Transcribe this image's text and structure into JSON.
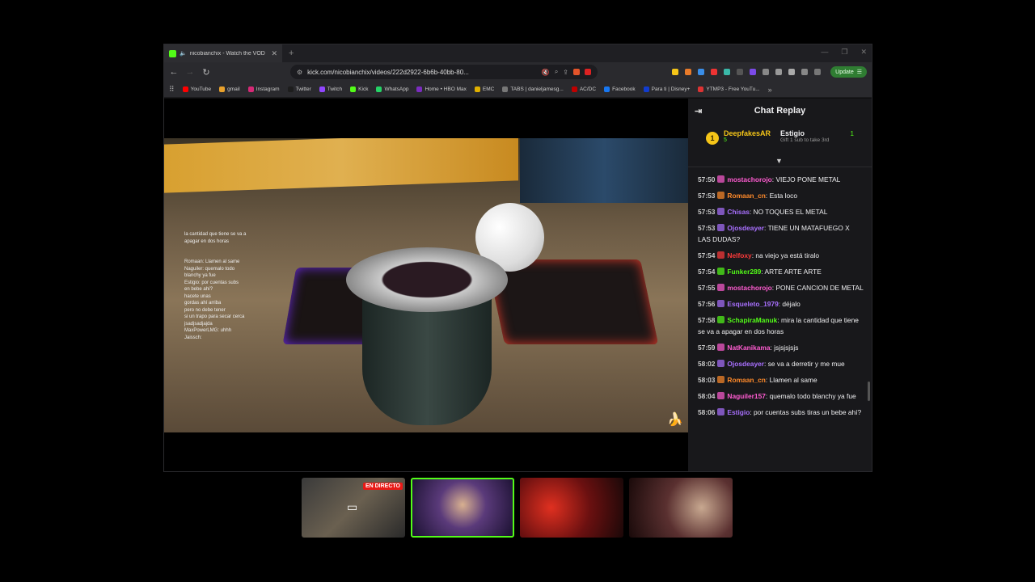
{
  "browser": {
    "tab_title": "nicobianchix - Watch the VOD",
    "new_tab_glyph": "+",
    "url": "kick.com/nicobianchix/videos/222d2922-6b6b-40bb-80...",
    "update_label": "Update",
    "bookmarks": [
      {
        "label": "YouTube",
        "color": "#ff0000"
      },
      {
        "label": "gmail",
        "color": "#e8a12c"
      },
      {
        "label": "Instagram",
        "color": "#d62976"
      },
      {
        "label": "Twitter",
        "color": "#1d1d1d"
      },
      {
        "label": "Twitch",
        "color": "#9146ff"
      },
      {
        "label": "Kick",
        "color": "#53fc18"
      },
      {
        "label": "WhatsApp",
        "color": "#25d366"
      },
      {
        "label": "Home • HBO Max",
        "color": "#7b2cbf"
      },
      {
        "label": "EMC",
        "color": "#e0b000"
      },
      {
        "label": "TABS | danieljamesg...",
        "color": "#777777"
      },
      {
        "label": "AC/DC",
        "color": "#c00000"
      },
      {
        "label": "Facebook",
        "color": "#1877f2"
      },
      {
        "label": "Para ti | Disney+",
        "color": "#113ccf"
      },
      {
        "label": "YTMP3 - Free YouTu...",
        "color": "#d33"
      }
    ]
  },
  "video": {
    "overlay_lines": [
      "la cantidad que tiene se va a",
      "apagar en dos horas",
      "",
      "",
      "Romaan: Llamen al same",
      "Naguiler: quemalo todo",
      "blanchy ya fue",
      "Estigio: por cuentas subs",
      "en bebe ahí?",
      "hacete unas",
      "gordas ahí arriba",
      "pero no debe tener",
      "si un trapo para secar cerca",
      "jsadjsadjajda",
      "MaxPowerLMG: uhhh",
      "Jaissch:"
    ],
    "banana": "🍌"
  },
  "chat": {
    "title": "Chat Replay",
    "pinned": {
      "first": {
        "rank": "1",
        "name": "DeepfakesAR",
        "count": "5"
      },
      "second": {
        "name": "Estigio",
        "subtitle": "Gift 1 sub to take 3rd",
        "count": "1"
      }
    },
    "messages": [
      {
        "time": "57:50",
        "user": "mostachorojo",
        "color": "#ff5cd1",
        "text": "VIEJO PONE METAL"
      },
      {
        "time": "57:53",
        "user": "Romaan_cn",
        "color": "#ff8a2a",
        "text": "Esta loco"
      },
      {
        "time": "57:53",
        "user": "Chisas",
        "color": "#a970ff",
        "text": "NO TOQUES EL METAL"
      },
      {
        "time": "57:53",
        "user": "Ojosdeayer",
        "color": "#a970ff",
        "text": "TIENE UN MATAFUEGO X LAS DUDAS?"
      },
      {
        "time": "57:54",
        "user": "Nelfoxy",
        "color": "#ff3a3a",
        "text": "na viejo ya está tiralo"
      },
      {
        "time": "57:54",
        "user": "Funker289",
        "color": "#53fc18",
        "text": "ARTE ARTE ARTE"
      },
      {
        "time": "57:55",
        "user": "mostachorojo",
        "color": "#ff5cd1",
        "text": "PONE CANCION DE METAL"
      },
      {
        "time": "57:56",
        "user": "Esqueleto_1979",
        "color": "#a970ff",
        "text": "déjalo"
      },
      {
        "time": "57:58",
        "user": "SchapiraManuk",
        "color": "#53fc18",
        "text": "mira la cantidad que tiene se va a apagar en dos horas"
      },
      {
        "time": "57:59",
        "user": "NatKanikama",
        "color": "#ff5cd1",
        "text": "jsjsjsjsjs"
      },
      {
        "time": "58:02",
        "user": "Ojosdeayer",
        "color": "#a970ff",
        "text": "se va a derretir y me mue"
      },
      {
        "time": "58:03",
        "user": "Romaan_cn",
        "color": "#ff8a2a",
        "text": "Llamen al same"
      },
      {
        "time": "58:04",
        "user": "Naguiler157",
        "color": "#ff5cd1",
        "text": "quemalo todo blanchy ya fue"
      },
      {
        "time": "58:06",
        "user": "Estigio",
        "color": "#a970ff",
        "text": "por cuentas subs tiras un bebe ahí?"
      }
    ]
  },
  "multistream": {
    "live_label": "EN DIRECTO"
  }
}
